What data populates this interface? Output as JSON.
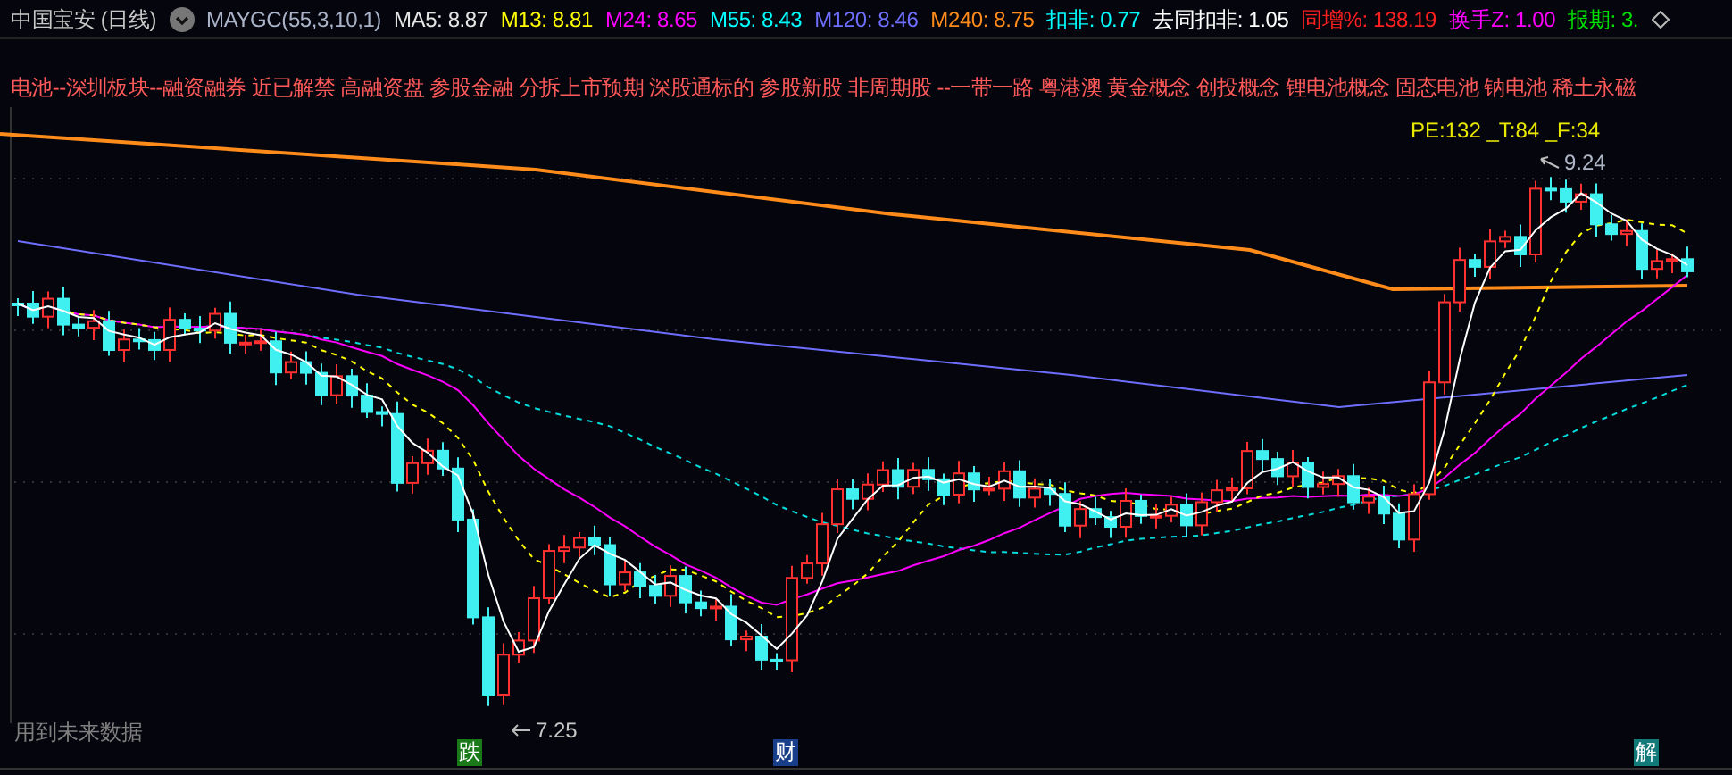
{
  "header": {
    "title": "中国宝安 (日线)",
    "indicator": "MAYGC(55,3,10,1)",
    "readings": [
      {
        "text": "MA5: 8.87",
        "color": "#e6e6e6"
      },
      {
        "text": "M13: 8.81",
        "color": "#ffff00"
      },
      {
        "text": "M24: 8.65",
        "color": "#ff00ff"
      },
      {
        "text": "M55: 8.43",
        "color": "#00ffff"
      },
      {
        "text": "M120: 8.46",
        "color": "#6f6fff"
      },
      {
        "text": "M240: 8.75",
        "color": "#ff8c1a"
      },
      {
        "text": "扣非: 0.77",
        "color": "#00ffff"
      },
      {
        "text": "去同扣非: 1.05",
        "color": "#ffffff"
      },
      {
        "text": "同增%: 138.19",
        "color": "#ff2020"
      },
      {
        "text": "换手Z: 1.00",
        "color": "#ff00ff"
      },
      {
        "text": "报期: 3.",
        "color": "#00e000"
      }
    ]
  },
  "concepts": "电池--深圳板块--融资融券 近已解禁 高融资盘 参股金融 分拆上市预期 深股通标的 参股新股 非周期股 --一带一路 粤港澳 黄金概念 创投概念 锂电池概念 固态电池 钠电池 稀土永磁",
  "chart": {
    "valuation": "PE:132 _T:84 _F:34",
    "high": "9.24",
    "low": "7.25",
    "note": "用到未来数据",
    "events": [
      {
        "text": "跌",
        "color": "#1a7a1a"
      },
      {
        "text": "财",
        "color": "#1a3f8a"
      },
      {
        "text": "解",
        "color": "#137a7a"
      }
    ]
  }
}
